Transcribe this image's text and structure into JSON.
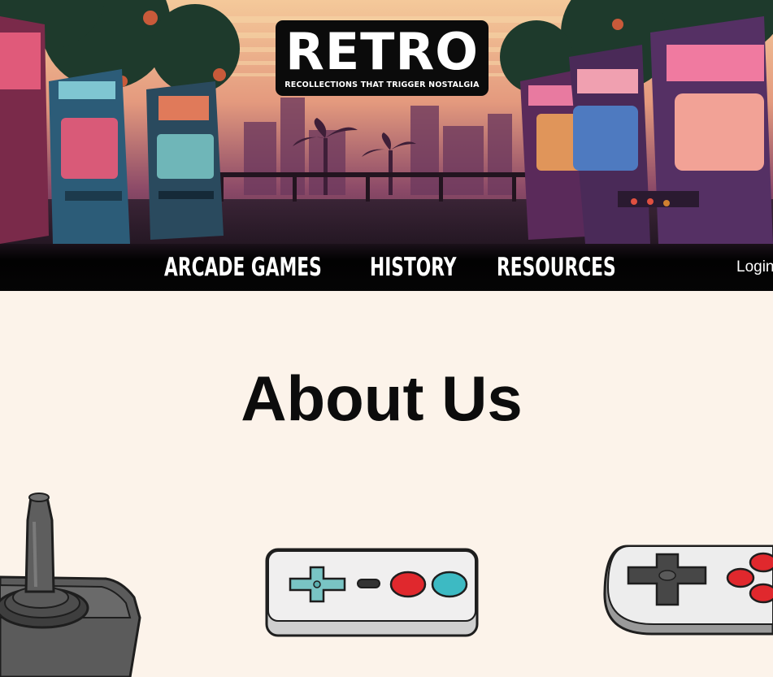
{
  "brand": {
    "title": "RETRO",
    "tagline": "RECOLLECTIONS THAT TRIGGER NOSTALGIA"
  },
  "nav": {
    "items": [
      {
        "label": "ARCADE GAMES"
      },
      {
        "label": "HISTORY"
      },
      {
        "label": "RESOURCES"
      }
    ],
    "login_label": "Login"
  },
  "main": {
    "heading": "About Us"
  },
  "illustrations": [
    {
      "icon": "joystick-icon"
    },
    {
      "icon": "gamepad-icon"
    },
    {
      "icon": "gamepad-icon"
    }
  ],
  "colors": {
    "page_bg": "#fcf3ea",
    "nav_bg": "#050505",
    "heading": "#0c0c0c",
    "button_red": "#e0282d",
    "button_teal": "#3dbac3",
    "dpad_teal": "#79c4c4"
  }
}
